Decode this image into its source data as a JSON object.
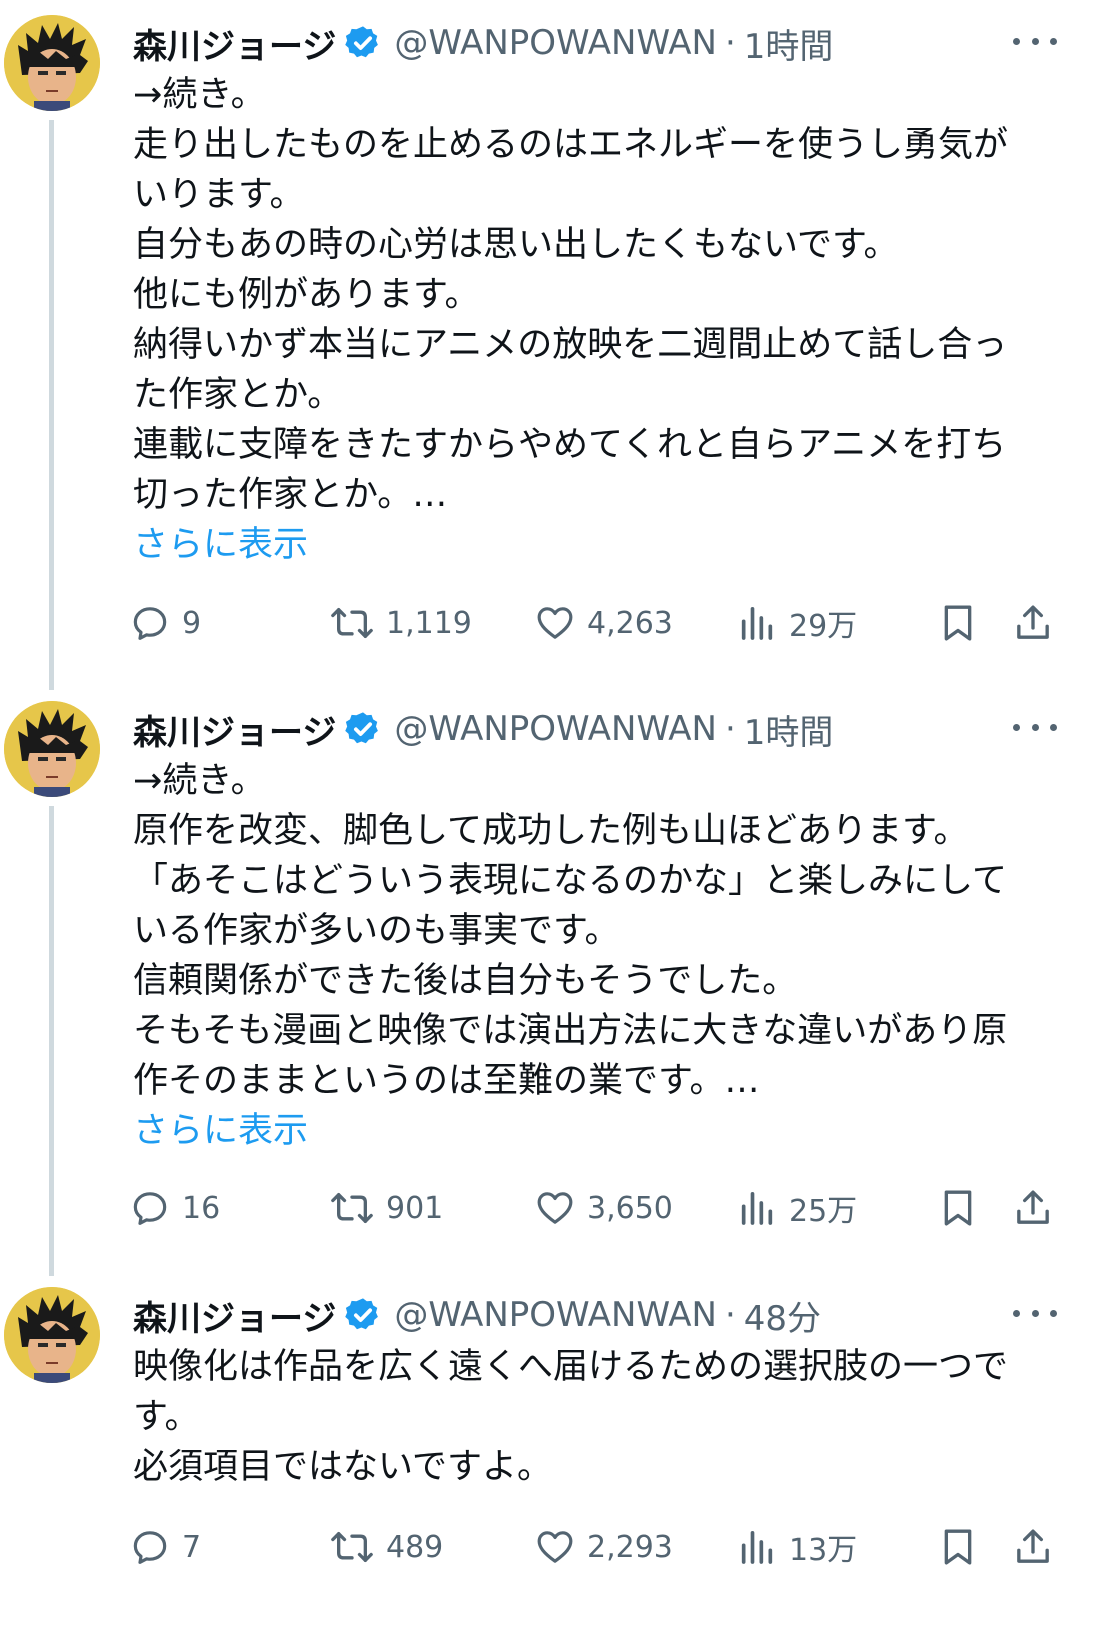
{
  "tweets": [
    {
      "author": "森川ジョージ",
      "handle": "@WANPOWANWAN",
      "separator": "·",
      "time": "1時間",
      "lines": [
        "→続き。",
        "走り出したものを止めるのはエネルギーを使うし勇気が",
        "いります。",
        "自分もあの時の心労は思い出したくもないです。",
        "他にも例があります。",
        "納得いかず本当にアニメの放映を二週間止めて話し合っ",
        "た作家とか。",
        "連載に支障をきたすからやめてくれと自らアニメを打ち",
        "切った作家とか。…"
      ],
      "show_more": "さらに表示",
      "replies": "9",
      "reposts": "1,119",
      "likes": "4,263",
      "views": "29万"
    },
    {
      "author": "森川ジョージ",
      "handle": "@WANPOWANWAN",
      "separator": "·",
      "time": "1時間",
      "lines": [
        "→続き。",
        "原作を改変、脚色して成功した例も山ほどあります。",
        "「あそこはどういう表現になるのかな」と楽しみにして",
        "いる作家が多いのも事実です。",
        "信頼関係ができた後は自分もそうでした。",
        "そもそも漫画と映像では演出方法に大きな違いがあり原",
        "作そのままというのは至難の業です。…"
      ],
      "show_more": "さらに表示",
      "replies": "16",
      "reposts": "901",
      "likes": "3,650",
      "views": "25万"
    },
    {
      "author": "森川ジョージ",
      "handle": "@WANPOWANWAN",
      "separator": "·",
      "time": "48分",
      "lines": [
        "映像化は作品を広く遠くへ届けるための選択肢の一つで",
        "す。",
        "必須項目ではないですよ。"
      ],
      "replies": "7",
      "reposts": "489",
      "likes": "2,293",
      "views": "13万"
    }
  ],
  "icons": {
    "reply": "reply-icon",
    "repost": "repost-icon",
    "like": "heart-icon",
    "views": "views-icon",
    "bookmark": "bookmark-icon",
    "share": "share-icon",
    "verified": "verified-badge-icon",
    "more": "more-options-icon"
  },
  "colors": {
    "text": "#0f1419",
    "secondary": "#536471",
    "link": "#1d9bf0",
    "verified": "#1d9bf0",
    "thread_line": "#cfd9de"
  }
}
